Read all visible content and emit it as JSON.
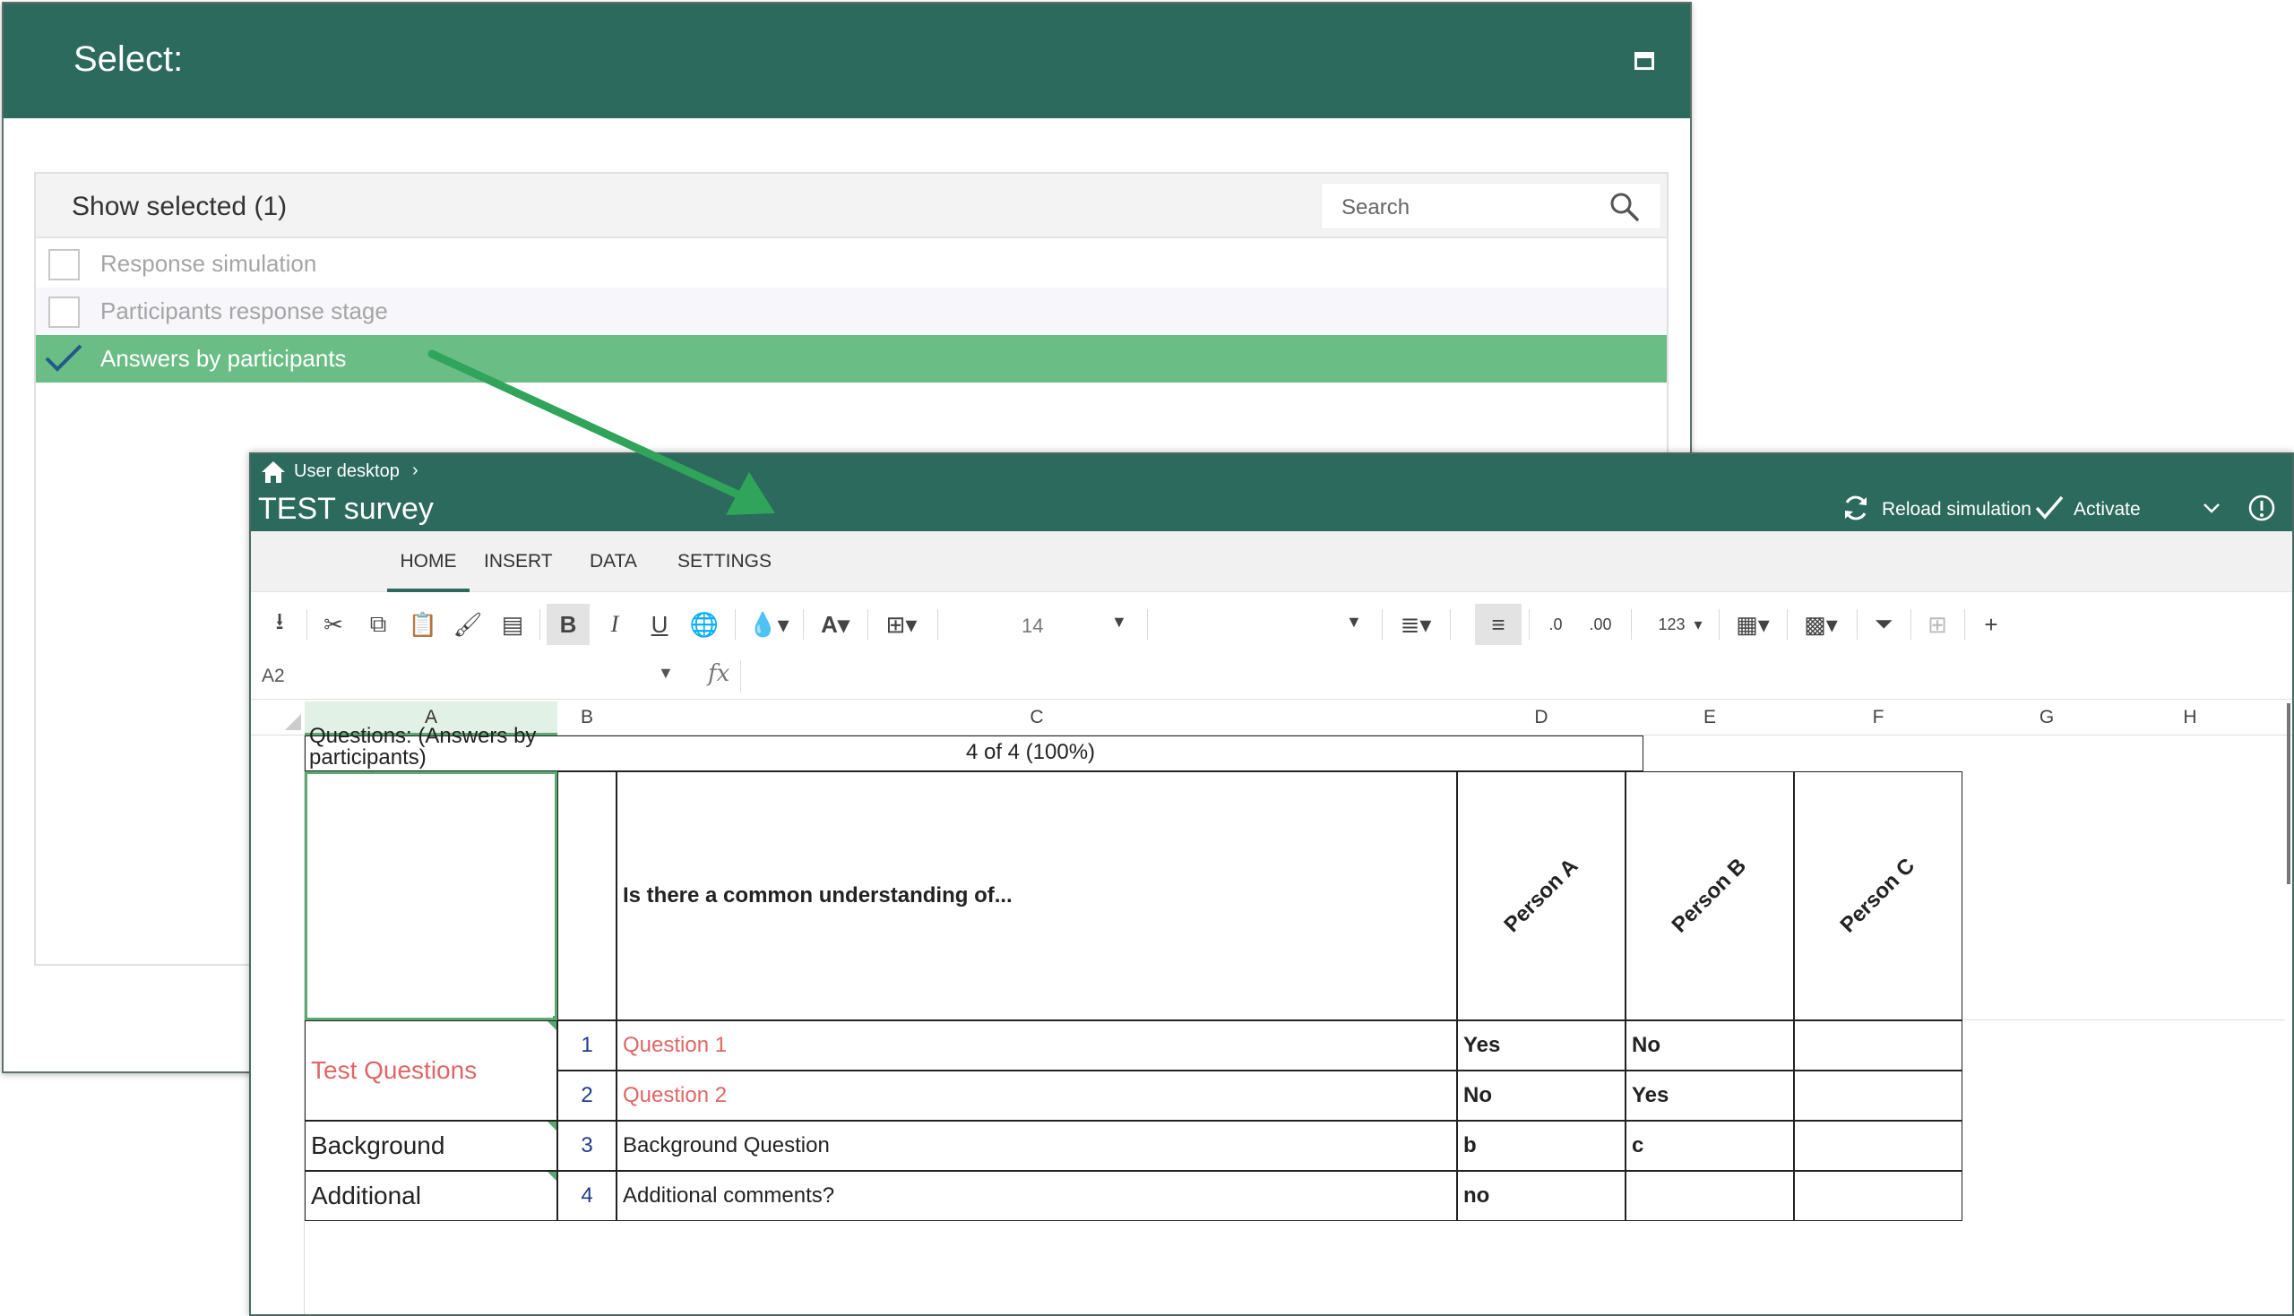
{
  "dialog": {
    "title": "Select:",
    "filter_label": "Show selected (1)",
    "search_placeholder": "Search",
    "items": [
      {
        "label": "Response simulation",
        "checked": false
      },
      {
        "label": "Participants response stage",
        "checked": false
      },
      {
        "label": "Answers by participants",
        "checked": true
      }
    ],
    "accent_color": "#2b6a5c",
    "selected_color": "#6bbd86"
  },
  "window": {
    "breadcrumb": "User desktop",
    "title": "TEST survey",
    "reload_label": "Reload simulation",
    "activate_label": "Activate",
    "tabs": [
      "HOME",
      "INSERT",
      "DATA",
      "SETTINGS"
    ],
    "active_tab": "HOME",
    "font_size": "14",
    "number_format_label": "123",
    "cell_ref": "A2",
    "fx_label": "fx"
  },
  "toolbar_icons": [
    "download-icon",
    "cut-icon",
    "copy-icon",
    "paste-icon",
    "format-painter-icon",
    "paste-special-icon",
    "bold-icon",
    "italic-icon",
    "underline-icon",
    "link-icon",
    "fill-color-icon",
    "font-color-icon",
    "borders-icon",
    "align-icon",
    "wrap-icon",
    "decrease-decimal-icon",
    "increase-decimal-icon",
    "number-format-icon",
    "cell-format-icon",
    "table-icon",
    "filter-icon",
    "freeze-icon",
    "add-icon"
  ],
  "toolbar_glyphs": {
    "bold": "B",
    "italic": "I",
    "underline": "U",
    "font_color": "A",
    "add": "+"
  },
  "grid": {
    "columns": [
      "A",
      "B",
      "C",
      "D",
      "E",
      "F",
      "G",
      "H"
    ],
    "header_cell": "Questions: (Answers by participants)",
    "progress": "4 of 4 (100%)",
    "question_header": "Is there a common understanding of...",
    "persons": [
      "Person A",
      "Person B",
      "Person C"
    ],
    "groups": [
      {
        "label": "Test Questions",
        "color": "#e06666"
      },
      {
        "label": "Background"
      },
      {
        "label": "Additional"
      }
    ],
    "rows": [
      {
        "num": "1",
        "question": "Question 1",
        "a": "Yes",
        "b": "No",
        "c": ""
      },
      {
        "num": "2",
        "question": "Question 2",
        "a": "No",
        "b": "Yes",
        "c": ""
      },
      {
        "num": "3",
        "question": "Background Question",
        "a": "b",
        "b": "c",
        "c": ""
      },
      {
        "num": "4",
        "question": "Additional comments?",
        "a": "no",
        "b": "",
        "c": ""
      }
    ]
  }
}
